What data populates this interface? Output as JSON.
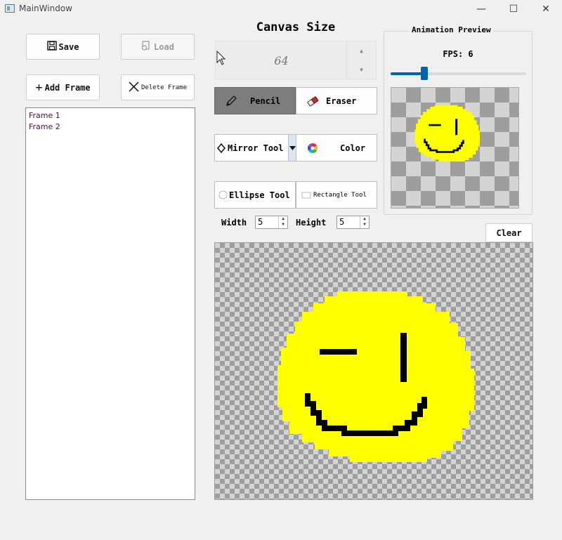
{
  "window": {
    "title": "MainWindow",
    "minimize": "—",
    "maximize": "☐",
    "close": "✕"
  },
  "file": {
    "save_label": "Save",
    "load_label": "Load"
  },
  "frames": {
    "add_label": "Add Frame",
    "delete_label": "Delete Frame",
    "items": [
      "Frame 1",
      "Frame 2"
    ]
  },
  "canvas": {
    "title": "Canvas Size",
    "size_value": "64"
  },
  "tools": {
    "pencil": "Pencil",
    "eraser": "Eraser",
    "mirror": "Mirror Tool",
    "color": "Color",
    "ellipse": "Ellipse Tool",
    "rectangle": "Rectangle Tool",
    "active": "pencil"
  },
  "brush": {
    "width_label": "Width",
    "width_value": "5",
    "height_label": "Height",
    "height_value": "5"
  },
  "preview": {
    "title": "Animation Preview",
    "fps_label": "FPS: 6",
    "fps_value": 6,
    "fps_slider_fraction": 0.25
  },
  "clear_label": "Clear",
  "colors": {
    "accent": "#0063b1",
    "paint": "#ffff00",
    "ink": "#000000",
    "checker_light": "#d4d4d4",
    "checker_dark": "#9e9e9e"
  },
  "icons": {
    "save": "floppy-disk-icon",
    "load": "load-icon",
    "add": "plus-icon",
    "delete": "x-icon",
    "pencil": "pencil-icon",
    "eraser": "eraser-icon",
    "mirror": "diamond-icon",
    "color": "color-wheel-icon",
    "ellipse": "circle-icon",
    "rectangle": "rectangle-icon"
  }
}
